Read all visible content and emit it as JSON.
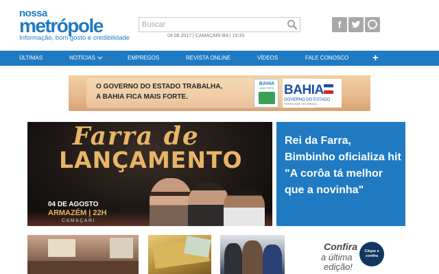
{
  "header": {
    "logo_top": "nossa",
    "logo_main": "metrópole",
    "tagline": "Informação, bom gosto e credibilidade",
    "search_placeholder": "Buscar",
    "date_line": "04.08.2017 | CAMAÇARI-BA | 19:33",
    "social": [
      {
        "icon": "facebook-icon",
        "glyph": "f"
      },
      {
        "icon": "twitter-icon",
        "glyph": "t"
      },
      {
        "icon": "chat-icon",
        "glyph": "◌"
      }
    ]
  },
  "nav": {
    "items": [
      "ÚLTIMAS",
      "NOTÍCIAS",
      "EMPREGOS",
      "REVISTA ONLINE",
      "VÍDEOS",
      "FALE CONOSCO"
    ],
    "more_glyph": "+",
    "color": "#1f7ac2"
  },
  "ad": {
    "line1": "O GOVERNO DO ESTADO TRABALHA,",
    "line2": "A BAHIA FICA MAIS FORTE.",
    "box_title": "BAHIA",
    "box_sub": "MAIS FORTE",
    "brand": "BAHIA",
    "brand_sub": "GOVERNO DO ESTADO",
    "brand_sub2": "TERRA MÃE DO BRASIL"
  },
  "feature": {
    "title_line1": "Farra de",
    "title_line2": "LANÇAMENTO",
    "date": "04 DE AGOSTO",
    "place": "ARMAZÉM | 22H",
    "city": "CAMAÇARI",
    "headline": "Rei da Farra, Bimbinho oficializa hit \"A corôa tá melhor que a novinha\""
  },
  "promo": {
    "line1": "Confira",
    "line2": "a última",
    "line3": "edição!",
    "badge": "Clique e confira"
  }
}
